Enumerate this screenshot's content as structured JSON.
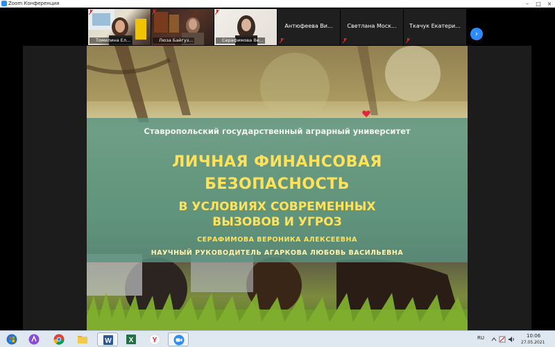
{
  "window": {
    "title": "Zoom Конференция"
  },
  "participants": [
    {
      "name": "Томилина Ел...",
      "has_video": true
    },
    {
      "name": "Люза Байгуз...",
      "has_video": true
    },
    {
      "name": "Серафимова Ве...",
      "has_video": true
    },
    {
      "name": "Антюфеева Ви...",
      "has_video": false
    },
    {
      "name": "Светлана Моск...",
      "has_video": false
    },
    {
      "name": "Ткачук Екатери...",
      "has_video": false
    }
  ],
  "gallery": {
    "next_icon": "chevron-right-icon"
  },
  "slide": {
    "university": "Ставропольский государственный аграрный университет",
    "title_line1": "ЛИЧНАЯ ФИНАНСОВАЯ",
    "title_line2": "БЕЗОПАСНОСТЬ",
    "subtitle_line1": "В УСЛОВИЯХ СОВРЕМЕННЫХ",
    "subtitle_line2": "ВЫЗОВОВ И УГРОЗ",
    "author": "СЕРАФИМОВА ВЕРОНИКА АЛЕКСЕЕВНА",
    "advisor": "НАУЧНЫЙ РУКОВОДИТЕЛЬ АГАРКОВА ЛЮБОВЬ ВАСИЛЬЕВНА"
  },
  "taskbar": {
    "apps": [
      "start-orb",
      "alice-icon",
      "chrome-icon",
      "file-explorer-icon",
      "word-icon",
      "excel-icon",
      "yandex-browser-icon",
      "zoom-icon"
    ],
    "language": "RU",
    "time": "10:06",
    "date": "27.05.2021"
  },
  "colors": {
    "zoom_blue": "#2d8cff",
    "slide_band": "#5a9280",
    "slide_title": "#ffe25a",
    "muted_mic": "#e02828"
  }
}
